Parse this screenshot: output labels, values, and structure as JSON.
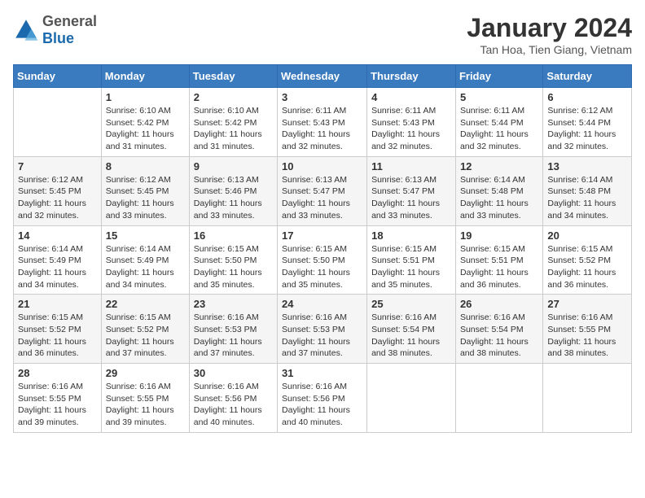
{
  "header": {
    "logo": {
      "general": "General",
      "blue": "Blue"
    },
    "title": "January 2024",
    "location": "Tan Hoa, Tien Giang, Vietnam"
  },
  "days_of_week": [
    "Sunday",
    "Monday",
    "Tuesday",
    "Wednesday",
    "Thursday",
    "Friday",
    "Saturday"
  ],
  "weeks": [
    [
      {
        "day": "",
        "sunrise": "",
        "sunset": "",
        "daylight": ""
      },
      {
        "day": "1",
        "sunrise": "Sunrise: 6:10 AM",
        "sunset": "Sunset: 5:42 PM",
        "daylight": "Daylight: 11 hours and 31 minutes."
      },
      {
        "day": "2",
        "sunrise": "Sunrise: 6:10 AM",
        "sunset": "Sunset: 5:42 PM",
        "daylight": "Daylight: 11 hours and 31 minutes."
      },
      {
        "day": "3",
        "sunrise": "Sunrise: 6:11 AM",
        "sunset": "Sunset: 5:43 PM",
        "daylight": "Daylight: 11 hours and 32 minutes."
      },
      {
        "day": "4",
        "sunrise": "Sunrise: 6:11 AM",
        "sunset": "Sunset: 5:43 PM",
        "daylight": "Daylight: 11 hours and 32 minutes."
      },
      {
        "day": "5",
        "sunrise": "Sunrise: 6:11 AM",
        "sunset": "Sunset: 5:44 PM",
        "daylight": "Daylight: 11 hours and 32 minutes."
      },
      {
        "day": "6",
        "sunrise": "Sunrise: 6:12 AM",
        "sunset": "Sunset: 5:44 PM",
        "daylight": "Daylight: 11 hours and 32 minutes."
      }
    ],
    [
      {
        "day": "7",
        "sunrise": "Sunrise: 6:12 AM",
        "sunset": "Sunset: 5:45 PM",
        "daylight": "Daylight: 11 hours and 32 minutes."
      },
      {
        "day": "8",
        "sunrise": "Sunrise: 6:12 AM",
        "sunset": "Sunset: 5:45 PM",
        "daylight": "Daylight: 11 hours and 33 minutes."
      },
      {
        "day": "9",
        "sunrise": "Sunrise: 6:13 AM",
        "sunset": "Sunset: 5:46 PM",
        "daylight": "Daylight: 11 hours and 33 minutes."
      },
      {
        "day": "10",
        "sunrise": "Sunrise: 6:13 AM",
        "sunset": "Sunset: 5:47 PM",
        "daylight": "Daylight: 11 hours and 33 minutes."
      },
      {
        "day": "11",
        "sunrise": "Sunrise: 6:13 AM",
        "sunset": "Sunset: 5:47 PM",
        "daylight": "Daylight: 11 hours and 33 minutes."
      },
      {
        "day": "12",
        "sunrise": "Sunrise: 6:14 AM",
        "sunset": "Sunset: 5:48 PM",
        "daylight": "Daylight: 11 hours and 33 minutes."
      },
      {
        "day": "13",
        "sunrise": "Sunrise: 6:14 AM",
        "sunset": "Sunset: 5:48 PM",
        "daylight": "Daylight: 11 hours and 34 minutes."
      }
    ],
    [
      {
        "day": "14",
        "sunrise": "Sunrise: 6:14 AM",
        "sunset": "Sunset: 5:49 PM",
        "daylight": "Daylight: 11 hours and 34 minutes."
      },
      {
        "day": "15",
        "sunrise": "Sunrise: 6:14 AM",
        "sunset": "Sunset: 5:49 PM",
        "daylight": "Daylight: 11 hours and 34 minutes."
      },
      {
        "day": "16",
        "sunrise": "Sunrise: 6:15 AM",
        "sunset": "Sunset: 5:50 PM",
        "daylight": "Daylight: 11 hours and 35 minutes."
      },
      {
        "day": "17",
        "sunrise": "Sunrise: 6:15 AM",
        "sunset": "Sunset: 5:50 PM",
        "daylight": "Daylight: 11 hours and 35 minutes."
      },
      {
        "day": "18",
        "sunrise": "Sunrise: 6:15 AM",
        "sunset": "Sunset: 5:51 PM",
        "daylight": "Daylight: 11 hours and 35 minutes."
      },
      {
        "day": "19",
        "sunrise": "Sunrise: 6:15 AM",
        "sunset": "Sunset: 5:51 PM",
        "daylight": "Daylight: 11 hours and 36 minutes."
      },
      {
        "day": "20",
        "sunrise": "Sunrise: 6:15 AM",
        "sunset": "Sunset: 5:52 PM",
        "daylight": "Daylight: 11 hours and 36 minutes."
      }
    ],
    [
      {
        "day": "21",
        "sunrise": "Sunrise: 6:15 AM",
        "sunset": "Sunset: 5:52 PM",
        "daylight": "Daylight: 11 hours and 36 minutes."
      },
      {
        "day": "22",
        "sunrise": "Sunrise: 6:15 AM",
        "sunset": "Sunset: 5:52 PM",
        "daylight": "Daylight: 11 hours and 37 minutes."
      },
      {
        "day": "23",
        "sunrise": "Sunrise: 6:16 AM",
        "sunset": "Sunset: 5:53 PM",
        "daylight": "Daylight: 11 hours and 37 minutes."
      },
      {
        "day": "24",
        "sunrise": "Sunrise: 6:16 AM",
        "sunset": "Sunset: 5:53 PM",
        "daylight": "Daylight: 11 hours and 37 minutes."
      },
      {
        "day": "25",
        "sunrise": "Sunrise: 6:16 AM",
        "sunset": "Sunset: 5:54 PM",
        "daylight": "Daylight: 11 hours and 38 minutes."
      },
      {
        "day": "26",
        "sunrise": "Sunrise: 6:16 AM",
        "sunset": "Sunset: 5:54 PM",
        "daylight": "Daylight: 11 hours and 38 minutes."
      },
      {
        "day": "27",
        "sunrise": "Sunrise: 6:16 AM",
        "sunset": "Sunset: 5:55 PM",
        "daylight": "Daylight: 11 hours and 38 minutes."
      }
    ],
    [
      {
        "day": "28",
        "sunrise": "Sunrise: 6:16 AM",
        "sunset": "Sunset: 5:55 PM",
        "daylight": "Daylight: 11 hours and 39 minutes."
      },
      {
        "day": "29",
        "sunrise": "Sunrise: 6:16 AM",
        "sunset": "Sunset: 5:55 PM",
        "daylight": "Daylight: 11 hours and 39 minutes."
      },
      {
        "day": "30",
        "sunrise": "Sunrise: 6:16 AM",
        "sunset": "Sunset: 5:56 PM",
        "daylight": "Daylight: 11 hours and 40 minutes."
      },
      {
        "day": "31",
        "sunrise": "Sunrise: 6:16 AM",
        "sunset": "Sunset: 5:56 PM",
        "daylight": "Daylight: 11 hours and 40 minutes."
      },
      {
        "day": "",
        "sunrise": "",
        "sunset": "",
        "daylight": ""
      },
      {
        "day": "",
        "sunrise": "",
        "sunset": "",
        "daylight": ""
      },
      {
        "day": "",
        "sunrise": "",
        "sunset": "",
        "daylight": ""
      }
    ]
  ]
}
